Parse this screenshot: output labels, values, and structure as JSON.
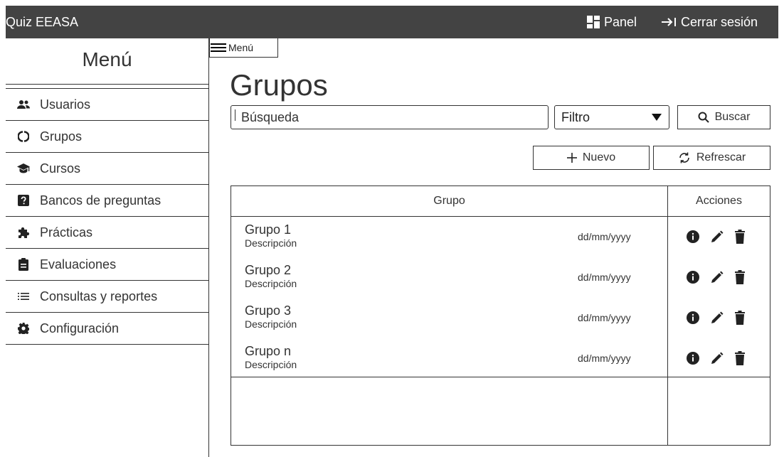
{
  "app": {
    "title": "Quiz EEASA"
  },
  "topbar": {
    "panel_label": "Panel",
    "logout_label": "Cerrar sesión"
  },
  "sidebar": {
    "title": "Menú",
    "items": [
      {
        "label": "Usuarios",
        "icon": "users-icon"
      },
      {
        "label": "Grupos",
        "icon": "groups-icon"
      },
      {
        "label": "Cursos",
        "icon": "graduation-cap-icon"
      },
      {
        "label": "Bancos de preguntas",
        "icon": "question-icon"
      },
      {
        "label": "Prácticas",
        "icon": "puzzle-icon"
      },
      {
        "label": "Evaluaciones",
        "icon": "clipboard-icon"
      },
      {
        "label": "Consultas y reportes",
        "icon": "list-icon"
      },
      {
        "label": "Configuración",
        "icon": "gear-icon"
      }
    ]
  },
  "main": {
    "menu_toggle": "Menú",
    "title": "Grupos",
    "search": {
      "placeholder": "Búsqueda"
    },
    "filter": {
      "value": "Filtro"
    },
    "buttons": {
      "search": "Buscar",
      "new": "Nuevo",
      "refresh": "Refrescar"
    },
    "table": {
      "headers": {
        "group": "Grupo",
        "actions": "Acciones"
      },
      "rows": [
        {
          "name": "Grupo 1",
          "description": "Descripción",
          "date": "dd/mm/yyyy"
        },
        {
          "name": "Grupo 2",
          "description": "Descripción",
          "date": "dd/mm/yyyy"
        },
        {
          "name": "Grupo 3",
          "description": "Descripción",
          "date": "dd/mm/yyyy"
        },
        {
          "name": "Grupo n",
          "description": "Descripción",
          "date": "dd/mm/yyyy"
        }
      ]
    }
  }
}
